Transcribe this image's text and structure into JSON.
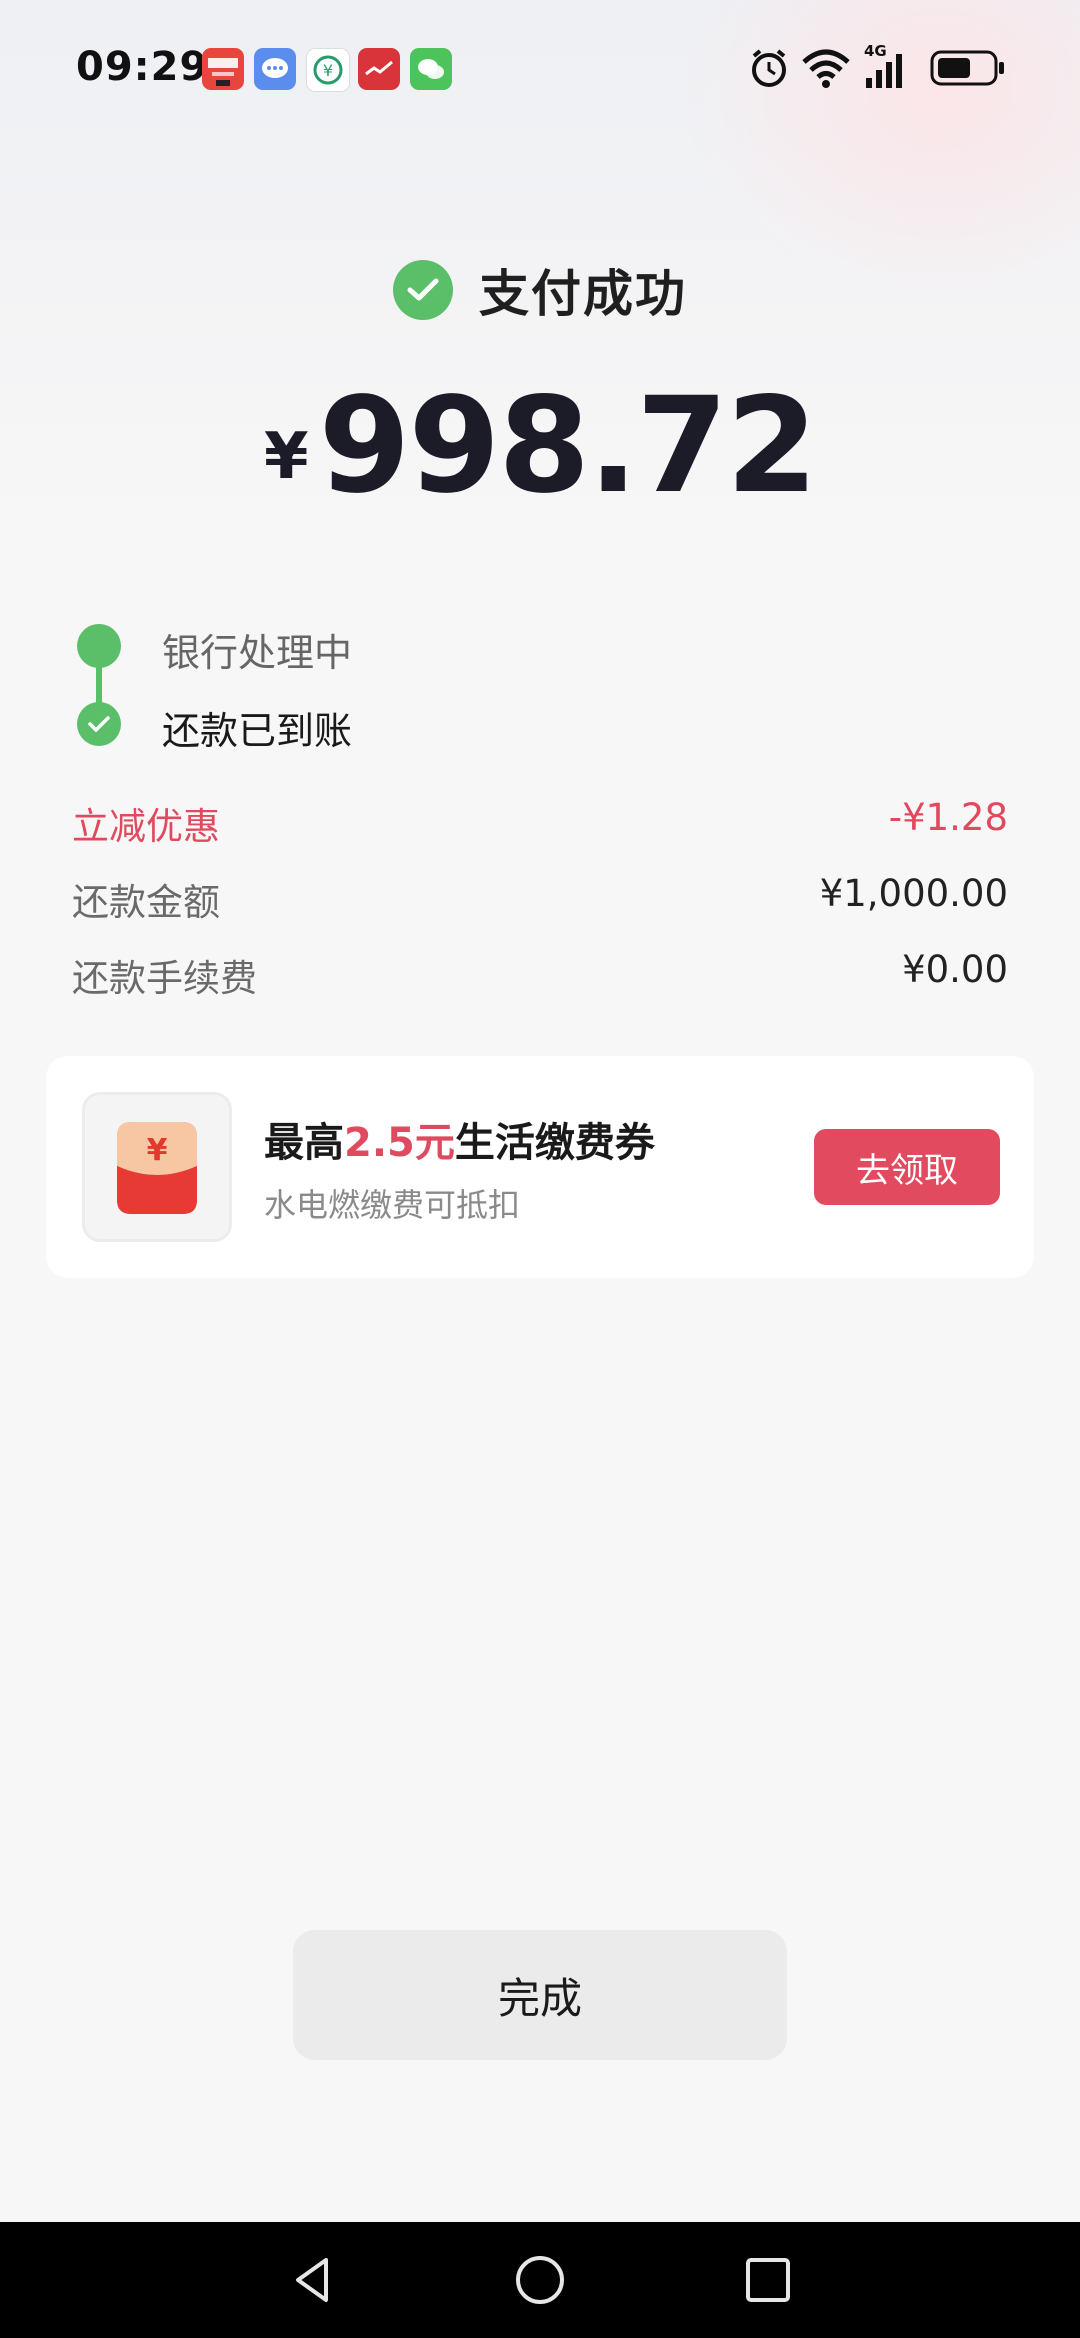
{
  "status_bar": {
    "time": "09:29",
    "notification_icons": [
      "pay-app-icon",
      "message-icon",
      "bank-app-icon",
      "red-app-icon",
      "wechat-icon"
    ],
    "system_icons": [
      "alarm-icon",
      "wifi-icon",
      "signal-4g-icon",
      "battery-icon"
    ],
    "network_label": "4G"
  },
  "header": {
    "title": "支付成功",
    "currency_symbol": "¥",
    "amount": "998.72"
  },
  "progress": {
    "steps": [
      {
        "label": "银行处理中",
        "done": false
      },
      {
        "label": "还款已到账",
        "done": true
      }
    ]
  },
  "details": [
    {
      "label": "立减优惠",
      "value": "-¥1.28"
    },
    {
      "label": "还款金额",
      "value": "¥1,000.00"
    },
    {
      "label": "还款手续费",
      "value": "¥0.00"
    }
  ],
  "promo": {
    "title_prefix": "最高",
    "title_highlight": "2.5元",
    "title_suffix": "生活缴费券",
    "subtitle": "水电燃缴费可抵扣",
    "button_label": "去领取",
    "icon_symbol": "¥"
  },
  "footer": {
    "done_label": "完成"
  },
  "colors": {
    "success_green": "#5bbf6a",
    "accent_red": "#e24a5f",
    "text_dark": "#1c1c28"
  }
}
